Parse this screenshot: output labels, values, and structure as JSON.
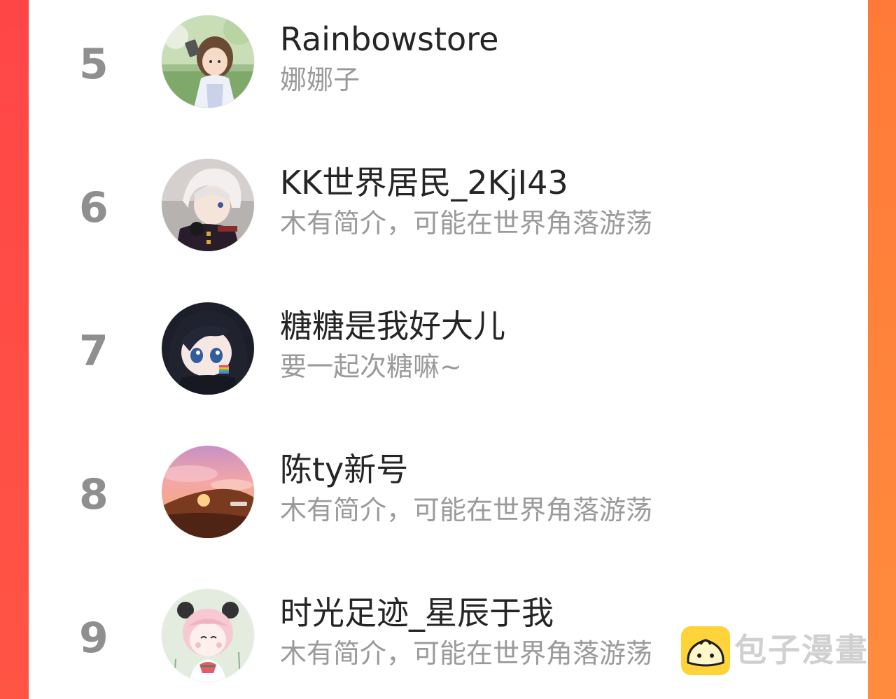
{
  "colors": {
    "accent_left": "#ff4a45",
    "accent_right": "#ff8a3a",
    "card_bg": "#ffffff",
    "rank": "#8f8f8f",
    "name": "#252525",
    "bio": "#9a9a9a",
    "watermark_logo": "#ffd43a"
  },
  "ranking": [
    {
      "rank": "5",
      "name": "Rainbowstore",
      "bio": "娜娜子",
      "avatar": "avatar-girl-photo"
    },
    {
      "rank": "6",
      "name": "KK世界居民_2KjI43",
      "bio": "木有简介，可能在世界角落游荡",
      "avatar": "avatar-white-hair-boy"
    },
    {
      "rank": "7",
      "name": "糖糖是我好大儿",
      "bio": "要一起次糖嘛~",
      "avatar": "avatar-dark-hair-chibi"
    },
    {
      "rank": "8",
      "name": "陈ty新号",
      "bio": "木有简介，可能在世界角落游荡",
      "avatar": "avatar-sunset"
    },
    {
      "rank": "9",
      "name": "时光足迹_星辰于我",
      "bio": "木有简介，可能在世界角落游荡",
      "avatar": "avatar-pink-panda-girl"
    }
  ],
  "watermark": {
    "text": "包子漫畫",
    "icon": "bun-mascot-icon"
  }
}
